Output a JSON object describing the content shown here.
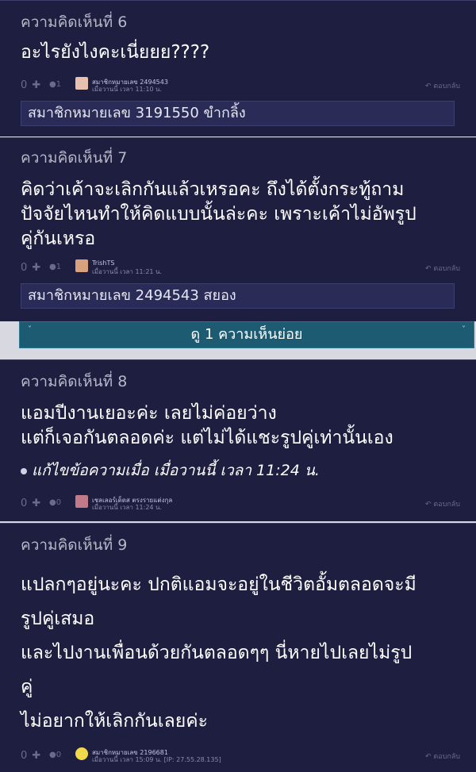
{
  "comments": [
    {
      "header": "ความคิดเห็นที่ 6",
      "body": [
        "อะไรยังไงคะเนี่ยยย????"
      ],
      "votes": "0 ✚",
      "count": "●1",
      "user": "สมาชิกหมายเลข 2494543",
      "time": "เมื่อวานนี้ เวลา 11:10 น.",
      "reply": "ตอบกลับ",
      "sub": "สมาชิกหมายเลข 3191550 ขำกลิ้ง"
    },
    {
      "header": "ความคิดเห็นที่ 7",
      "body": [
        "คิดว่าเค้าจะเลิกกันแล้วเหรอคะ ถึงได้ตั้งกระทู้ถาม",
        "ปัจจัยไหนทำให้คิดแบบนั้นล่ะคะ เพราะเค้าไม่อัพรูป",
        "คู่กันเหรอ"
      ],
      "votes": "0 ✚",
      "count": "●1",
      "user": "TrishTS",
      "time": "เมื่อวานนี้ เวลา 11:21 น.",
      "reply": "ตอบกลับ",
      "sub": "สมาชิกหมายเลข 2494543 สยอง"
    },
    {
      "header": "ความคิดเห็นที่ 8",
      "body": [
        "แอมปีงานเยอะค่ะ เลยไม่ค่อยว่าง",
        "แต่ก็เจอกันตลอดค่ะ แต่ไม่ได้แชะรูปคู่เท่านั้นเอง"
      ],
      "edit": "แก้ไขข้อความเมื่อ เมื่อวานนี้ เวลา 11:24 น.",
      "votes": "0 ✚",
      "count": "●0",
      "user": "เชลเลอร์เด็ดส ตรงรายแต่งกุล",
      "time": "เมื่อวานนี้ เวลา 11:24 น.",
      "reply": "ตอบกลับ"
    },
    {
      "header": "ความคิดเห็นที่ 9",
      "body": [
        "แปลกๆอยู่นะคะ ปกติแอมจะอยู่ในชีวิตอั้มตลอดจะมี",
        "รูปคู่เสมอ",
        "และไปงานเพื่อนด้วยกันตลอดๆๆ นี่หายไปเลยไม่รูป",
        "คู่",
        "ไม่อยากให้เลิกกันเลยค่ะ"
      ],
      "votes": "0 ✚",
      "count": "●0",
      "user": "สมาชิกหมายเลข 2196681",
      "time": "เมื่อวานนี้ เวลา 15:09 น. [IP: 27.55.28.135]",
      "reply": "ตอบกลับ"
    }
  ],
  "expand_label": "ดู 1 ความเห็นย่อย",
  "colors": {
    "card_bg": "#1d1e40",
    "subbox_bg": "#2a2b57",
    "expand_bg": "#1d5b72"
  }
}
